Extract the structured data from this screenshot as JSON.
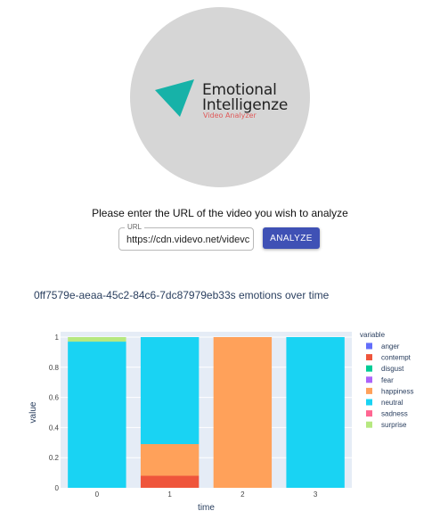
{
  "logo": {
    "title_line1": "Emotional",
    "title_line2": "Intelligenze",
    "subtitle": "Video Analyzer",
    "mark_color": "#17b2a8",
    "circle_color": "#d6d6d6",
    "subtitle_color": "#e05a5a"
  },
  "form": {
    "prompt": "Please enter the URL of the video you wish to analyze",
    "url_label": "URL",
    "url_value": "https://cdn.videvo.net/videvc",
    "button_label": "ANALYZE",
    "button_color": "#3f51b5"
  },
  "chart_data": {
    "type": "bar",
    "stacked": true,
    "title": "0ff7579e-aeaa-45c2-84c6-7dc87979eb33s emotions over time",
    "xlabel": "time",
    "ylabel": "value",
    "categories": [
      "0",
      "1",
      "2",
      "3"
    ],
    "ylim": [
      0,
      1
    ],
    "yticks": [
      "0",
      "0.2",
      "0.4",
      "0.6",
      "0.8",
      "1"
    ],
    "grid": true,
    "legend_title": "variable",
    "legend_position": "right",
    "series": [
      {
        "name": "anger",
        "color": "#636efa",
        "values": [
          0,
          0,
          0,
          0
        ]
      },
      {
        "name": "contempt",
        "color": "#ef553b",
        "values": [
          0,
          0.08,
          0,
          0
        ]
      },
      {
        "name": "disgust",
        "color": "#00cc96",
        "values": [
          0,
          0,
          0,
          0
        ]
      },
      {
        "name": "fear",
        "color": "#ab63fa",
        "values": [
          0,
          0,
          0,
          0
        ]
      },
      {
        "name": "happiness",
        "color": "#ffa15a",
        "values": [
          0,
          0.21,
          1.0,
          0
        ]
      },
      {
        "name": "neutral",
        "color": "#19d3f3",
        "values": [
          0.97,
          0.71,
          0,
          1.0
        ]
      },
      {
        "name": "sadness",
        "color": "#ff6692",
        "values": [
          0,
          0,
          0,
          0
        ]
      },
      {
        "name": "surprise",
        "color": "#b6e880",
        "values": [
          0.03,
          0,
          0,
          0
        ]
      }
    ]
  }
}
